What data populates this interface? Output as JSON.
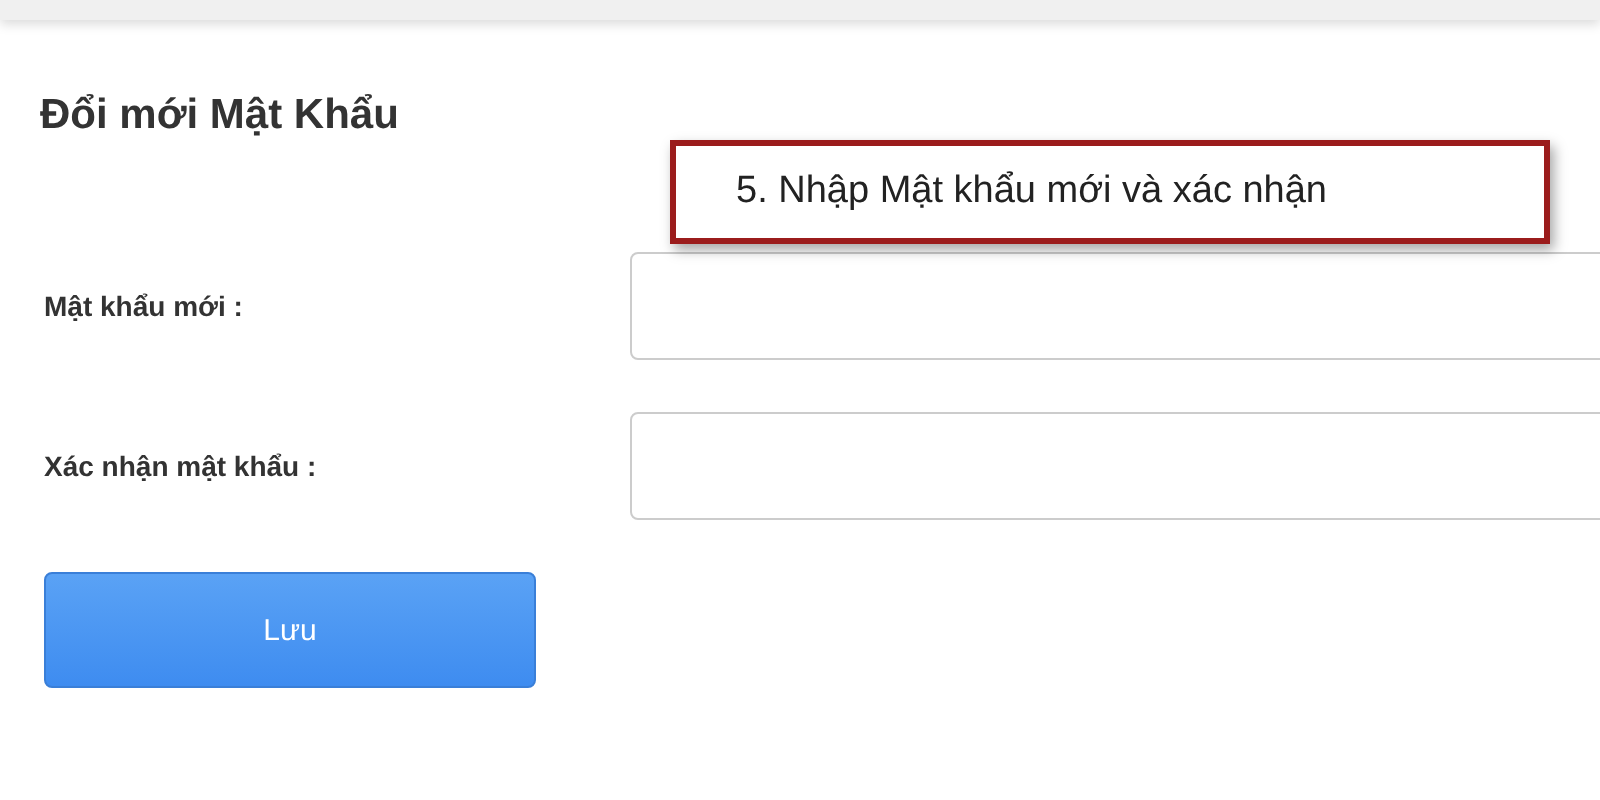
{
  "title": "Đổi mới Mật Khẩu",
  "callout": {
    "text": "5. Nhập Mật khẩu mới và xác nhận"
  },
  "fields": [
    {
      "label": "Mật khẩu mới :"
    },
    {
      "label": "Xác nhận mật khẩu :"
    }
  ],
  "save_button": {
    "label": "Lưu"
  }
}
